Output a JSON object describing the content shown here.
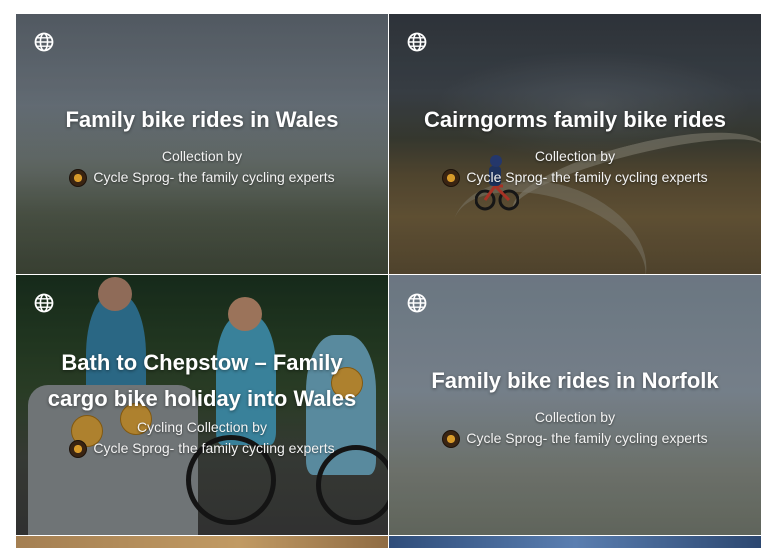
{
  "cards": [
    {
      "title": "Family bike rides in Wales",
      "byline": "Collection by",
      "author": "Cycle Sprog- the family cycling experts",
      "icon": "globe-icon"
    },
    {
      "title": "Cairngorms family bike rides",
      "byline": "Collection by",
      "author": "Cycle Sprog- the family cycling experts",
      "icon": "globe-icon"
    },
    {
      "title": "Bath to Chepstow – Family cargo bike holiday into Wales",
      "byline": "Cycling Collection by",
      "author": "Cycle Sprog- the family cycling experts",
      "icon": "globe-icon"
    },
    {
      "title": "Family bike rides in Norfolk",
      "byline": "Collection by",
      "author": "Cycle Sprog- the family cycling experts",
      "icon": "globe-icon"
    }
  ],
  "colors": {
    "text": "#ffffff",
    "overlay": "#000000"
  }
}
